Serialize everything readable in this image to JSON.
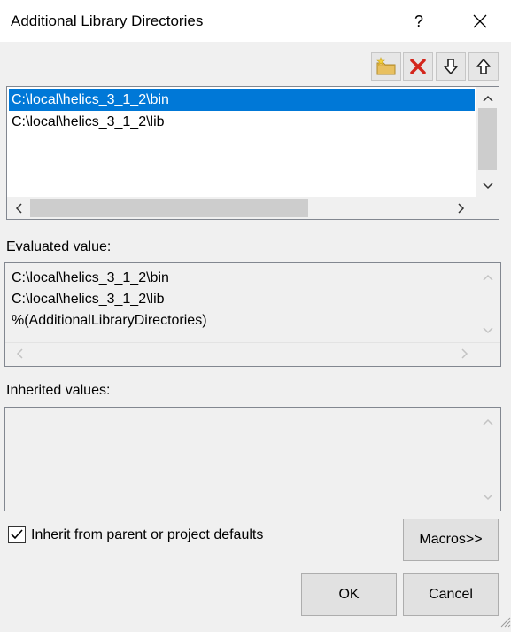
{
  "window": {
    "title": "Additional Library Directories",
    "help_label": "?"
  },
  "toolbar": {
    "buttons": [
      {
        "icon": "new-folder-icon"
      },
      {
        "icon": "delete-icon"
      },
      {
        "icon": "move-down-icon"
      },
      {
        "icon": "move-up-icon"
      }
    ]
  },
  "list": {
    "items": [
      {
        "text": "C:\\local\\helics_3_1_2\\bin",
        "selected": true
      },
      {
        "text": "C:\\local\\helics_3_1_2\\lib",
        "selected": false
      }
    ]
  },
  "evaluated": {
    "label": "Evaluated value:",
    "lines": [
      "C:\\local\\helics_3_1_2\\bin",
      "C:\\local\\helics_3_1_2\\lib",
      "%(AdditionalLibraryDirectories)"
    ]
  },
  "inherited": {
    "label": "Inherited values:"
  },
  "inherit_checkbox": {
    "label": "Inherit from parent or project defaults",
    "checked": true
  },
  "buttons": {
    "macros": "Macros>>",
    "ok": "OK",
    "cancel": "Cancel"
  },
  "colors": {
    "selection": "#0078d7",
    "dialog_bg": "#f0f0f0"
  }
}
